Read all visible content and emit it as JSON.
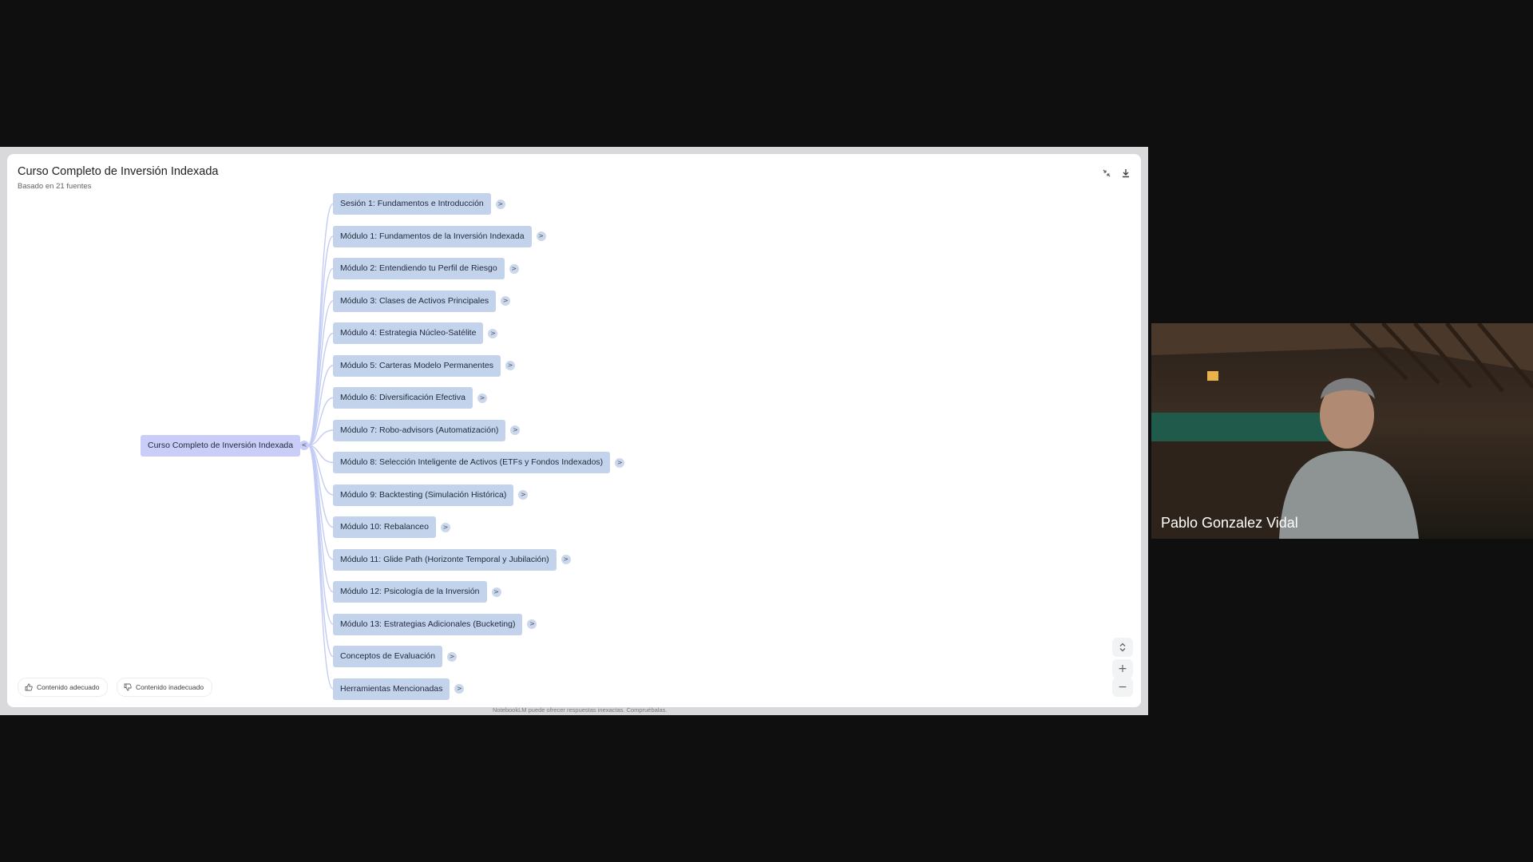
{
  "mindmap": {
    "title": "Curso Completo de Inversión Indexada",
    "subtitle": "Basado en 21 fuentes",
    "root": "Curso Completo de Inversión Indexada",
    "collapse_glyph": "<",
    "expand_glyph": ">",
    "nodes": [
      "Sesión 1: Fundamentos e Introducción",
      "Módulo 1: Fundamentos de la Inversión Indexada",
      "Módulo 2: Entendiendo tu Perfil de Riesgo",
      "Módulo 3: Clases de Activos Principales",
      "Módulo 4: Estrategia Núcleo-Satélite",
      "Módulo 5: Carteras Modelo Permanentes",
      "Módulo 6: Diversificación Efectiva",
      "Módulo 7: Robo-advisors (Automatización)",
      "Módulo 8: Selección Inteligente de Activos (ETFs y Fondos Indexados)",
      "Módulo 9: Backtesting (Simulación Histórica)",
      "Módulo 10: Rebalanceo",
      "Módulo 11: Glide Path (Horizonte Temporal y Jubilación)",
      "Módulo 12: Psicología de la Inversión",
      "Módulo 13: Estrategias Adicionales (Bucketing)",
      "Conceptos de Evaluación",
      "Herramientas Mencionadas"
    ]
  },
  "feedback": {
    "good_label": "Contenido adecuado",
    "bad_label": "Contenido inadecuado"
  },
  "zoom": {
    "plus": "+",
    "minus": "−"
  },
  "disclaimer": "NotebookLM puede ofrecer respuestas inexactas. Compruébalas.",
  "participant": {
    "name": "Pablo Gonzalez Vidal"
  },
  "colors": {
    "node": "#c3d3ec",
    "root_node": "#c9cdf7",
    "connector": "#c2ccf5"
  }
}
